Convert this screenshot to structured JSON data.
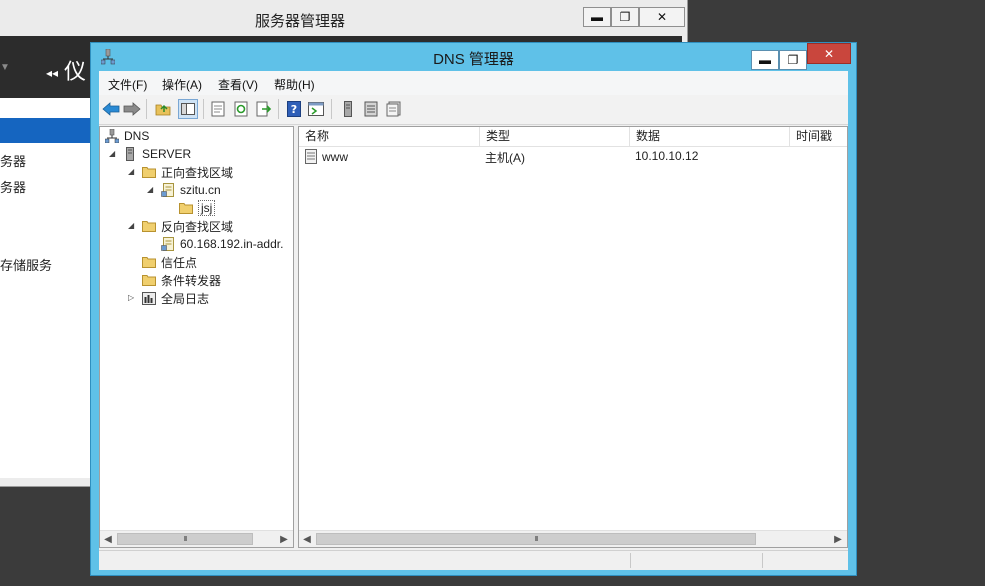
{
  "background_window": {
    "title": "服务器管理器",
    "header_title": "仪",
    "nav_items": [
      "务器",
      "务器",
      "存储服务"
    ],
    "controls": {
      "minimize": "▬",
      "maximize": "❐",
      "close": "✕"
    }
  },
  "dns_window": {
    "title": "DNS 管理器",
    "controls": {
      "minimize": "▬",
      "maximize": "❐",
      "close": "✕"
    },
    "menu": [
      "文件(F)",
      "操作(A)",
      "查看(V)",
      "帮助(H)"
    ],
    "toolbar_icons": [
      "back-arrow-icon",
      "forward-arrow-icon",
      "up-folder-icon",
      "show-hide-tree-icon",
      "properties-icon",
      "refresh-icon",
      "export-list-icon",
      "help-icon",
      "console-icon",
      "server-icon",
      "zone-icon",
      "records-icon"
    ],
    "tree": {
      "root": "DNS",
      "server": "SERVER",
      "forward_zones": "正向查找区域",
      "zone": "szitu.cn",
      "subdomain": "jsj",
      "reverse_zones": "反向查找区域",
      "reverse_zone": "60.168.192.in-addr.",
      "trust_points": "信任点",
      "conditional_forwarders": "条件转发器",
      "global_logs": "全局日志"
    },
    "list": {
      "columns": [
        "名称",
        "类型",
        "数据",
        "时间戳"
      ],
      "rows": [
        {
          "name": "www",
          "type": "主机(A)",
          "data": "10.10.10.12",
          "timestamp": ""
        }
      ]
    },
    "scrollbar": {
      "left": "◀",
      "right": "▶",
      "thumb": "III"
    }
  },
  "colors": {
    "dns_frame": "#5fc1e8",
    "selection_blue": "#1565c0",
    "close_red": "#c9463d",
    "desktop": "#3b3b3b"
  }
}
